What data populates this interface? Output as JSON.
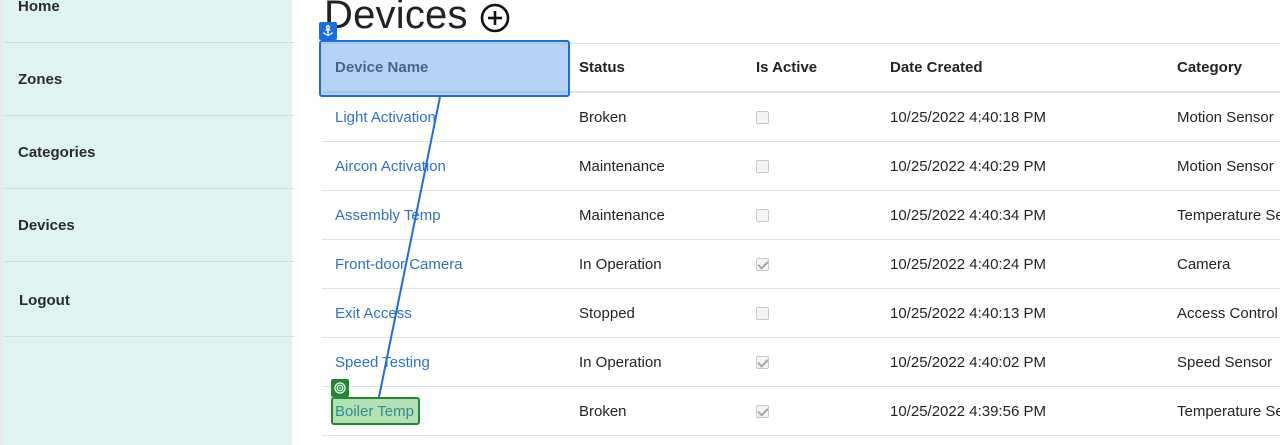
{
  "sidebar": {
    "items": [
      {
        "label": "Home"
      },
      {
        "label": "Zones"
      },
      {
        "label": "Categories"
      },
      {
        "label": "Devices"
      },
      {
        "label": "Logout"
      }
    ]
  },
  "page": {
    "title": "Devices",
    "add_icon": "add-circle-icon"
  },
  "table": {
    "columns": [
      "Device Name",
      "Status",
      "Is Active",
      "Date Created",
      "Category"
    ],
    "rows": [
      {
        "name": "Light Activation",
        "status": "Broken",
        "active": false,
        "created": "10/25/2022 4:40:18 PM",
        "category": "Motion Sensor"
      },
      {
        "name": "Aircon Activation",
        "status": "Maintenance",
        "active": false,
        "created": "10/25/2022 4:40:29 PM",
        "category": "Motion Sensor"
      },
      {
        "name": "Assembly Temp",
        "status": "Maintenance",
        "active": false,
        "created": "10/25/2022 4:40:34 PM",
        "category": "Temperature Se"
      },
      {
        "name": "Front-door Camera",
        "status": "In Operation",
        "active": true,
        "created": "10/25/2022 4:40:24 PM",
        "category": "Camera"
      },
      {
        "name": "Exit Access",
        "status": "Stopped",
        "active": false,
        "created": "10/25/2022 4:40:13 PM",
        "category": "Access Control"
      },
      {
        "name": "Speed Testing",
        "status": "In Operation",
        "active": true,
        "created": "10/25/2022 4:40:02 PM",
        "category": "Speed Sensor"
      },
      {
        "name": "Boiler Temp",
        "status": "Broken",
        "active": true,
        "created": "10/25/2022 4:39:56 PM",
        "category": "Temperature Se"
      }
    ]
  },
  "overlay": {
    "anchor_icon": "anchor-icon",
    "target_icon": "target-icon",
    "colors": {
      "anchor": "#1a6fe0",
      "target": "#1f8a2e"
    }
  }
}
